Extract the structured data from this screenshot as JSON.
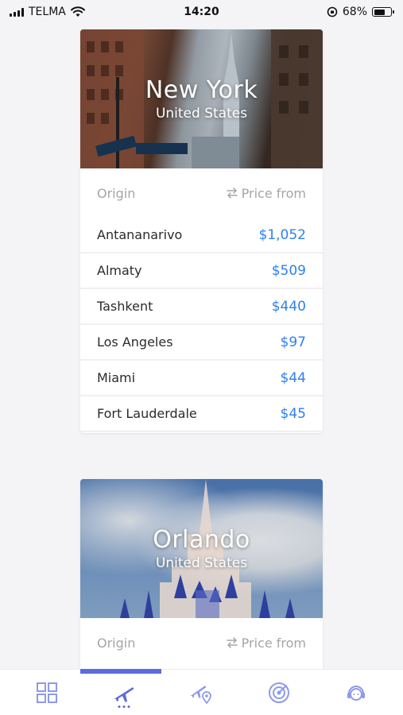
{
  "status_bar": {
    "carrier": "TELMA",
    "time": "14:20",
    "battery_percent": "68%",
    "battery_level": 0.68
  },
  "cards": [
    {
      "city": "New York",
      "country": "United States",
      "header": {
        "origin": "Origin",
        "price": "Price from"
      },
      "rows": [
        {
          "origin": "Antananarivo",
          "price": "$1,052"
        },
        {
          "origin": "Almaty",
          "price": "$509"
        },
        {
          "origin": "Tashkent",
          "price": "$440"
        },
        {
          "origin": "Los Angeles",
          "price": "$97"
        },
        {
          "origin": "Miami",
          "price": "$44"
        },
        {
          "origin": "Fort Lauderdale",
          "price": "$45"
        }
      ]
    },
    {
      "city": "Orlando",
      "country": "United States",
      "header": {
        "origin": "Origin",
        "price": "Price from"
      }
    }
  ],
  "tabs": [
    {
      "name": "grid",
      "icon": "grid-icon",
      "active": false
    },
    {
      "name": "flights",
      "icon": "airplane-icon",
      "active": true
    },
    {
      "name": "flight-location",
      "icon": "plane-pin-icon",
      "active": false
    },
    {
      "name": "radar",
      "icon": "radar-icon",
      "active": false
    },
    {
      "name": "support",
      "icon": "support-agent-icon",
      "active": false
    }
  ],
  "colors": {
    "accent": "#5b6be0",
    "price": "#2f80ed",
    "muted": "#a5a5a5",
    "background": "#f4f4f6"
  }
}
